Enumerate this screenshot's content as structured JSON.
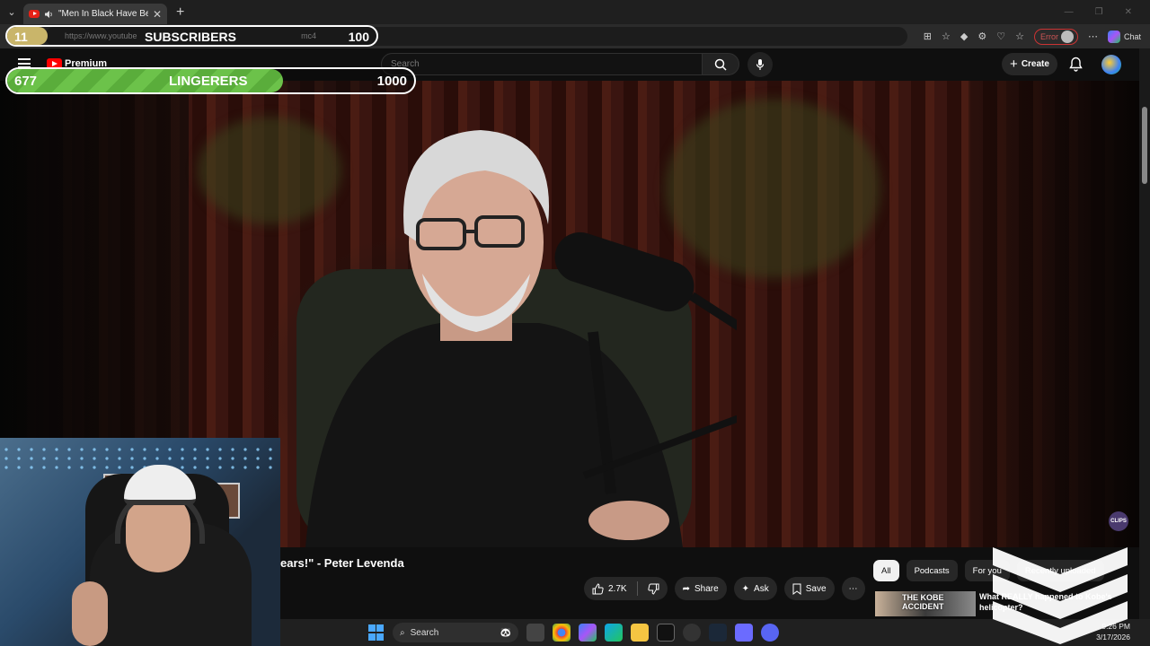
{
  "browser": {
    "tab_title": "\"Men In Black Have Been Wat",
    "url": "https://www.youtube",
    "url_suffix": "mc4",
    "error_label": "Error",
    "chat_label": "Chat"
  },
  "subscribers": {
    "current": "11",
    "label": "SUBSCRIBERS",
    "goal": "100",
    "progress": 0.11
  },
  "lingerers": {
    "current": "677",
    "label": "LINGERERS",
    "goal": "1000",
    "progress": 0.677
  },
  "youtube": {
    "logo_label": "Premium",
    "search_placeholder": "Search",
    "create_label": "Create"
  },
  "video": {
    "title_visible": "ears!\" - Peter Levenda",
    "clips_badge": "CLIPS"
  },
  "actions": {
    "like_count": "2.7K",
    "share_label": "Share",
    "ask_label": "Ask",
    "save_label": "Save"
  },
  "filters": [
    "All",
    "Podcasts",
    "For you",
    "Recently uploaded"
  ],
  "recommendation": {
    "thumb_text": "THE KOBE ACCIDENT",
    "title": "What REALLY happened to Kobe's helicopter?"
  },
  "taskbar": {
    "search_label": "Search",
    "time": "9:26 PM",
    "date": "3/17/2026"
  }
}
